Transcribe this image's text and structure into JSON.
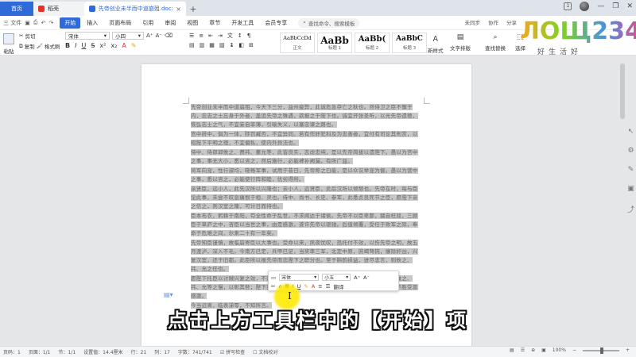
{
  "titlebar": {
    "tabs": [
      {
        "label": "首页"
      },
      {
        "label": "稻壳"
      },
      {
        "label": "先帝创业未半而中道崩殂.docx"
      }
    ],
    "add_tab": "+",
    "badge": "1"
  },
  "menubar": {
    "file_label": "三 文件",
    "items": [
      "开始",
      "插入",
      "页面布局",
      "引用",
      "审阅",
      "视图",
      "章节",
      "开发工具",
      "会员专享"
    ],
    "search_label": "查找命令、搜索模板",
    "right_items": [
      "未同步",
      "协作",
      "分享"
    ]
  },
  "ribbon": {
    "paste": "粘贴",
    "cut": "剪切",
    "copy": "复制",
    "format_painter": "格式刷",
    "font_name": "宋体",
    "font_size": "小四",
    "font_grow": "A⁺",
    "font_shrink": "A⁻",
    "bold": "B",
    "italic": "I",
    "underline": "U",
    "styles": [
      {
        "preview": "AaBbCcDd",
        "name": "正文"
      },
      {
        "preview": "AaBb",
        "name": "标题 1"
      },
      {
        "preview": "AaBb(",
        "name": "标题 2"
      },
      {
        "preview": "AaBbC",
        "name": "标题 3"
      }
    ],
    "new_style": "新样式",
    "text_layout": "文字排版",
    "find_replace": "查找替换",
    "select": "选择"
  },
  "logo": {
    "text": "ЛОЩ234",
    "sub": "好生活好"
  },
  "document": {
    "paragraphs": [
      "先帝创业未半而中道崩殂，今天下三分，益州疲弊，此诚危急存亡之秋也。然侍卫之臣不懈于内，忠志之士忘身于外者，盖追先帝之殊遇，欲报之于陛下也。诚宜开张圣听，以光先帝遗德，恢弘志士之气，不宜妄自菲薄，引喻失义，以塞忠谏之路也。",
      "宫中府中，俱为一体，陟罚臧否，不宜异同。若有作奸犯科及为忠善者，宜付有司论其刑赏，以昭陛下平明之理，不宜偏私，使内外异法也。",
      "侍中、侍郎郭攸之、费祎、董允等，此皆良实，志虑忠纯，是以先帝简拔以遗陛下。愚以为宫中之事，事无大小，悉以咨之，然后施行，必能裨补阙漏，有所广益。",
      "将军向宠，性行淑均，晓畅军事，试用于昔日，先帝称之曰能，是以众议举宠为督。愚以为营中之事，悉以咨之，必能使行阵和睦，优劣得所。",
      "亲贤臣，远小人，此先汉所以兴隆也；亲小人，远贤臣，此后汉所以倾颓也。先帝在时，每与臣论此事，未尝不叹息痛恨于桓、灵也。侍中、尚书、长史、参军，此悉贞良死节之臣，愿陛下亲之信之，则汉室之隆，可计日而待也。",
      "臣本布衣，躬耕于南阳，苟全性命于乱世，不求闻达于诸侯。先帝不以臣卑鄙，猥自枉屈，三顾臣于草庐之中，咨臣以当世之事，由是感激，遂许先帝以驱驰。后值倾覆，受任于败军之际，奉命于危难之间，尔来二十有一年矣。",
      "先帝知臣谨慎，故临崩寄臣以大事也。受命以来，夙夜忧叹，恐托付不效，以伤先帝之明，故五月渡泸，深入不毛。今南方已定，兵甲已足，当奖率三军，北定中原，庶竭驽钝，攘除奸凶，兴复汉室，还于旧都。此臣所以报先帝而忠陛下之职分也。至于斟酌损益，进尽忠言，则攸之、祎、允之任也。",
      "愿陛下托臣以讨贼兴复之效，不效，则治臣之罪，以告先帝之灵。若无兴德之言，则责攸之、祎、允等之慢，以彰其咎；陛下亦宜自谋，以咨诹善道，察纳雅言，深追先帝遗诏，臣不胜受恩感激。",
      "今当远离，临表涕零，不知所言。"
    ]
  },
  "mini_toolbar": {
    "font_name": "宋体",
    "font_size": "小五",
    "bold": "B",
    "italic": "I",
    "underline": "U",
    "translate": "翻译"
  },
  "caption": "点击上方工具栏中的【开始】项",
  "statusbar": {
    "page": "页码：1",
    "pages": "页面：1/1",
    "section": "节：1/1",
    "setting": "设置值：14.4厘米",
    "row": "行：21",
    "col": "列：17",
    "words": "字数：741/741",
    "spell": "拼写检查",
    "proof": "文档校对",
    "zoom": "100%"
  },
  "colors": {
    "accent": "#2f6ad9",
    "selection": "#c7c7c7",
    "cursor_highlight": "#ffe600"
  }
}
